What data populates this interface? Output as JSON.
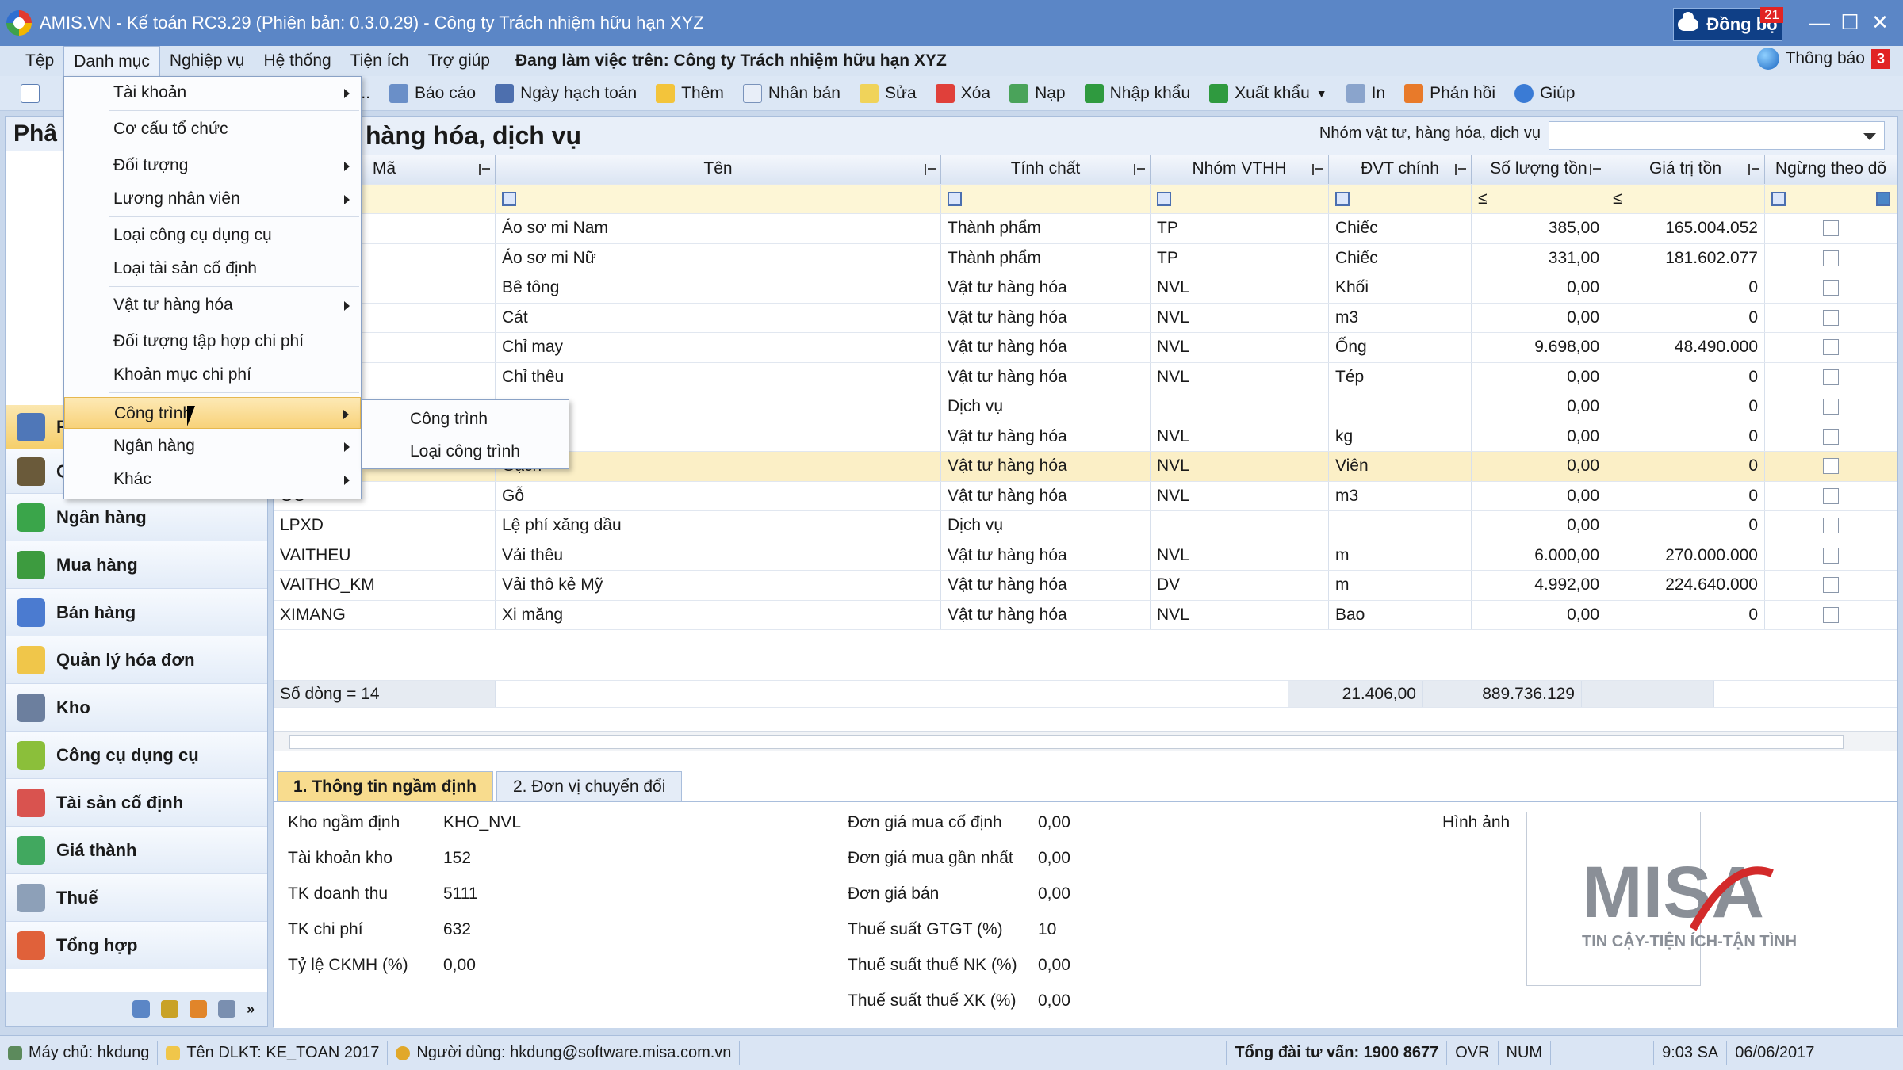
{
  "window": {
    "title": "AMIS.VN - Kế toán RC3.29 (Phiên bản: 0.3.0.29) - Công ty Trách nhiệm hữu hạn XYZ",
    "sync_label": "Đồng bộ",
    "sync_count": "21",
    "minimize": "—",
    "maximize": "☐",
    "close": "✕"
  },
  "menubar": {
    "items": [
      "Tệp",
      "Danh mục",
      "Nghiệp vụ",
      "Hệ thống",
      "Tiện ích",
      "Trợ giúp"
    ],
    "working_on": "Đang làm việc trên:  Công ty Trách nhiệm hữu hạn XYZ",
    "notify_label": "Thông báo",
    "notify_count": "3"
  },
  "toolbar": {
    "items": [
      "m...",
      "Báo cáo",
      "Ngày hạch toán",
      "Thêm",
      "Nhân bản",
      "Sửa",
      "Xóa",
      "Nạp",
      "Nhập khẩu",
      "Xuất khẩu",
      "In",
      "Phản hồi",
      "Giúp"
    ]
  },
  "leftpanel": {
    "title": "Phâ",
    "partial_items": [
      "R",
      "Q"
    ],
    "items": [
      "Ngân hàng",
      "Mua hàng",
      "Bán hàng",
      "Quản lý hóa đơn",
      "Kho",
      "Công cụ dụng cụ",
      "Tài sản cố định",
      "Giá thành",
      "Thuế",
      "Tổng hợp"
    ]
  },
  "main": {
    "title": "hàng hóa, dịch vụ",
    "group_label": "Nhóm vật tư, hàng hóa, dịch vụ",
    "columns": [
      "Mã",
      "Tên",
      "Tính chất",
      "Nhóm VTHH",
      "ĐVT chính",
      "Số lượng tồn",
      "Giá trị tồn",
      "Ngừng theo dõ"
    ],
    "filter_first": "ếm",
    "filter_le": "≤",
    "rows": [
      [
        "I",
        "Áo sơ mi Nam",
        "Thành phẩm",
        "TP",
        "Chiếc",
        "385,00",
        "165.004.052"
      ],
      [
        "",
        "Áo sơ mi Nữ",
        "Thành phẩm",
        "TP",
        "Chiếc",
        "331,00",
        "181.602.077"
      ],
      [
        "",
        "Bê tông",
        "Vật tư hàng hóa",
        "NVL",
        "Khối",
        "0,00",
        "0"
      ],
      [
        "",
        "Cát",
        "Vật tư hàng hóa",
        "NVL",
        "m3",
        "0,00",
        "0"
      ],
      [
        "",
        "Chỉ may",
        "Vật tư hàng hóa",
        "NVL",
        "Ống",
        "9.698,00",
        "48.490.000"
      ],
      [
        "",
        "Chỉ thêu",
        "Vật tư hàng hóa",
        "NVL",
        "Tép",
        "0,00",
        "0"
      ],
      [
        "",
        "ua hàng",
        "Dịch vụ",
        "",
        "",
        "0,00",
        "0"
      ],
      [
        "",
        "",
        "Vật tư hàng hóa",
        "NVL",
        "kg",
        "0,00",
        "0"
      ],
      [
        "",
        "Gạch",
        "Vật tư hàng hóa",
        "NVL",
        "Viên",
        "0,00",
        "0"
      ],
      [
        "GO",
        "Gỗ",
        "Vật tư hàng hóa",
        "NVL",
        "m3",
        "0,00",
        "0"
      ],
      [
        "LPXD",
        "Lệ phí xăng dầu",
        "Dịch vụ",
        "",
        "",
        "0,00",
        "0"
      ],
      [
        "VAITHEU",
        "Vải thêu",
        "Vật tư hàng hóa",
        "NVL",
        "m",
        "6.000,00",
        "270.000.000"
      ],
      [
        "VAITHO_KM",
        "Vải thô kẻ Mỹ",
        "Vật tư hàng hóa",
        "DV",
        "m",
        "4.992,00",
        "224.640.000"
      ],
      [
        "XIMANG",
        "Xi măng",
        "Vật tư hàng hóa",
        "NVL",
        "Bao",
        "0,00",
        "0"
      ]
    ],
    "summary": {
      "count": "Số dòng = 14",
      "qty": "21.406,00",
      "value": "889.736.129"
    }
  },
  "detail": {
    "tabs": [
      "1. Thông tin ngầm định",
      "2. Đơn vị chuyển đổi"
    ],
    "left": [
      [
        "Kho ngầm định",
        "KHO_NVL"
      ],
      [
        "Tài khoản kho",
        "152"
      ],
      [
        "TK doanh thu",
        "5111"
      ],
      [
        "TK chi phí",
        "632"
      ],
      [
        "Tỷ lệ CKMH (%)",
        "0,00"
      ]
    ],
    "right": [
      [
        "Đơn giá mua cố định",
        "0,00"
      ],
      [
        "Đơn giá mua gần nhất",
        "0,00"
      ],
      [
        "Đơn giá bán",
        "0,00"
      ],
      [
        "Thuế suất GTGT (%)",
        "10"
      ],
      [
        "Thuế suất thuế NK (%)",
        "0,00"
      ],
      [
        "Thuế suất thuế XK (%)",
        "0,00"
      ]
    ],
    "image_label": "Hình ảnh",
    "logo_text": "MISA",
    "logo_tagline": "TIN CẬY-TIỆN ÍCH-TẬN TÌNH"
  },
  "dropdown": {
    "items": [
      "Tài khoản",
      "Cơ cấu tổ chức",
      "Đối tượng",
      "Lương nhân viên",
      "Loại công cụ dụng cụ",
      "Loại tài sản cố định",
      "Vật tư hàng hóa",
      "Đối tượng tập hợp chi phí",
      "Khoản mục chi phí",
      "Công trình",
      "Ngân hàng",
      "Khác"
    ],
    "submenu": [
      "Công trình",
      "Loại công trình"
    ]
  },
  "statusbar": {
    "server": "Máy chủ: hkdung",
    "dlkt": "Tên DLKT: KE_TOAN 2017",
    "user": "Người dùng: hkdung@software.misa.com.vn",
    "hotline": "Tổng đài tư vấn: 1900 8677",
    "ovr": "OVR",
    "num": "NUM",
    "time": "9:03 SA",
    "date": "06/06/2017"
  },
  "colors": {
    "accent": "#5b86c6",
    "highlight": "#f8d27a",
    "brand_red": "#d32a2a"
  }
}
